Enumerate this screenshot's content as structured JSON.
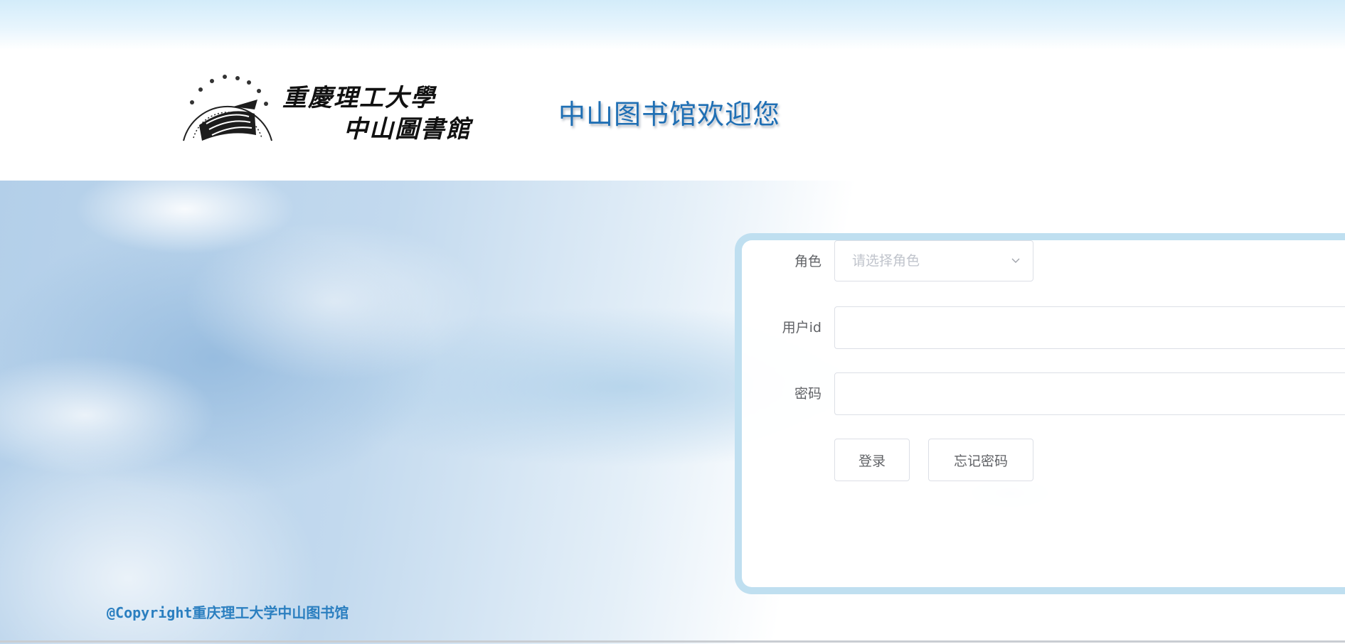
{
  "header": {
    "logo_text": [
      "重慶理工大學",
      "中山圖書館"
    ],
    "welcome_title": "中山图书馆欢迎您"
  },
  "login_form": {
    "role": {
      "label": "角色",
      "placeholder": "请选择角色"
    },
    "user_id": {
      "label": "用户id",
      "value": ""
    },
    "password": {
      "label": "密码",
      "value": ""
    },
    "login_button": "登录",
    "forgot_button": "忘记密码"
  },
  "footer": {
    "copyright": "@Copyright重庆理工大学中山图书馆"
  },
  "colors": {
    "title_blue": "#1f6fb4",
    "copyright_blue": "#2b7fc0",
    "panel_border": "#bfdff0"
  },
  "icons": {
    "select_arrow": "chevron-down-icon",
    "logo_seal": "library-seal-icon"
  }
}
